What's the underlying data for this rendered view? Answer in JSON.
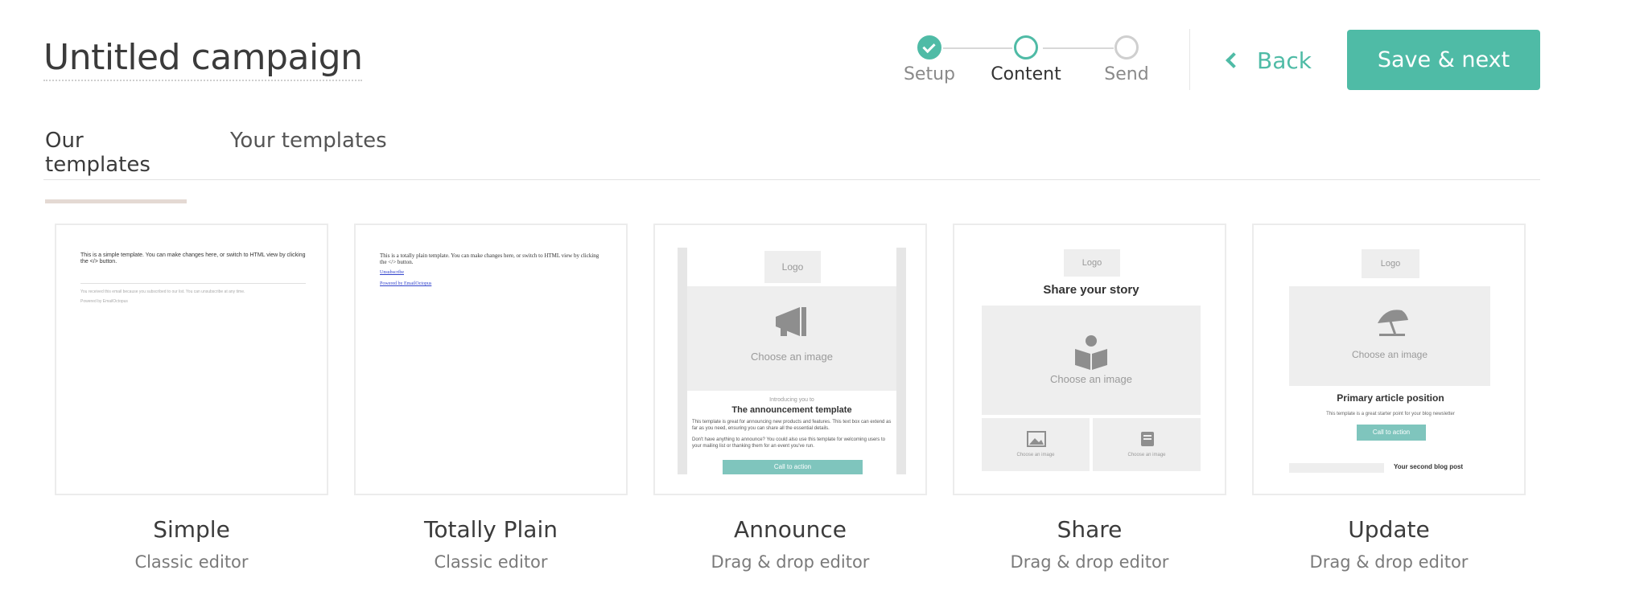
{
  "header": {
    "title": "Untitled campaign",
    "back_label": "Back",
    "save_label": "Save & next"
  },
  "stepper": {
    "steps": [
      {
        "label": "Setup",
        "state": "done"
      },
      {
        "label": "Content",
        "state": "current"
      },
      {
        "label": "Send",
        "state": "upcoming"
      }
    ]
  },
  "tabs": [
    {
      "label": "Our templates",
      "active": true
    },
    {
      "label": "Your templates",
      "active": false
    }
  ],
  "colors": {
    "accent": "#4fbba6",
    "tab_underline": "#e4d9d3"
  },
  "templates": [
    {
      "name": "Simple",
      "editor": "Classic editor",
      "preview": {
        "body": "This is a simple template. You can make changes here, or switch to HTML view by clicking the </> button.",
        "footer": "You received this email because you subscribed to our list. You can unsubscribe at any time.",
        "powered": "Powered by EmailOctopus"
      }
    },
    {
      "name": "Totally Plain",
      "editor": "Classic editor",
      "preview": {
        "body": "This is a totally plain template. You can make changes here, or switch to HTML view by clicking the </> button.",
        "unsubscribe": "Unsubscribe",
        "powered": "Powered by EmailOctopus"
      }
    },
    {
      "name": "Announce",
      "editor": "Drag & drop editor",
      "preview": {
        "logo": "Logo",
        "image_placeholder": "Choose an image",
        "intro": "Introducing you to",
        "heading": "The announcement template",
        "para1": "This template is great for announcing new products and features. This text box can extend as far as you need, ensuring you can share all the essential details.",
        "para2": "Don't have anything to announce? You could also use this template for welcoming users to your mailing list or thanking them for an event you've run.",
        "cta": "Call to action",
        "icon": "megaphone-icon"
      }
    },
    {
      "name": "Share",
      "editor": "Drag & drop editor",
      "preview": {
        "logo": "Logo",
        "heading": "Share your story",
        "image_placeholder": "Choose an image",
        "small_image_1": "Choose an image",
        "small_image_2": "Choose an image",
        "icon": "book-reader-icon"
      }
    },
    {
      "name": "Update",
      "editor": "Drag & drop editor",
      "preview": {
        "logo": "Logo",
        "image_placeholder": "Choose an image",
        "heading": "Primary article position",
        "para": "This template is a great starter point for your blog newsletter",
        "cta": "Call to action",
        "second_post": "Your second blog post",
        "icon": "beach-umbrella-icon"
      }
    }
  ]
}
